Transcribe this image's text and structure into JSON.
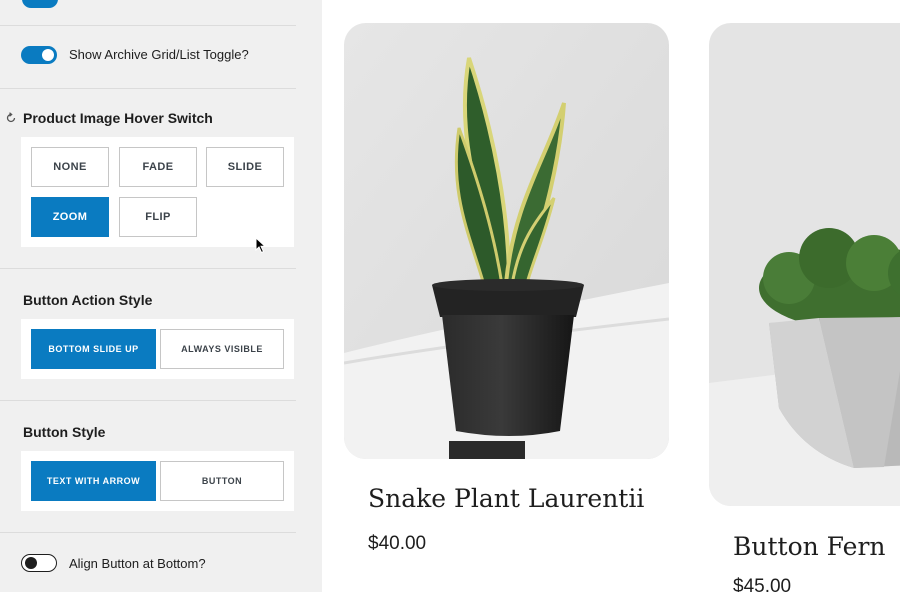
{
  "settings": {
    "archive_toggle": {
      "label": "Show Archive Grid/List Toggle?",
      "enabled": true
    },
    "hover_switch": {
      "title": "Product Image Hover Switch",
      "options": [
        "NONE",
        "FADE",
        "SLIDE",
        "ZOOM",
        "FLIP"
      ],
      "selected": "ZOOM"
    },
    "button_action_style": {
      "title": "Button Action Style",
      "options": [
        "BOTTOM SLIDE UP",
        "ALWAYS VISIBLE"
      ],
      "selected": "BOTTOM SLIDE UP"
    },
    "button_style": {
      "title": "Button Style",
      "options": [
        "TEXT WITH ARROW",
        "BUTTON"
      ],
      "selected": "TEXT WITH ARROW"
    },
    "align_bottom": {
      "label": "Align Button at Bottom?",
      "enabled": false
    }
  },
  "products": [
    {
      "name": "Snake Plant Laurentii",
      "price": "$40.00"
    },
    {
      "name": "Button Fern",
      "price": "$45.00"
    }
  ],
  "colors": {
    "accent": "#0a7bc1",
    "sidebar_bg": "#f0f0f0",
    "text": "#1e1e1e"
  }
}
